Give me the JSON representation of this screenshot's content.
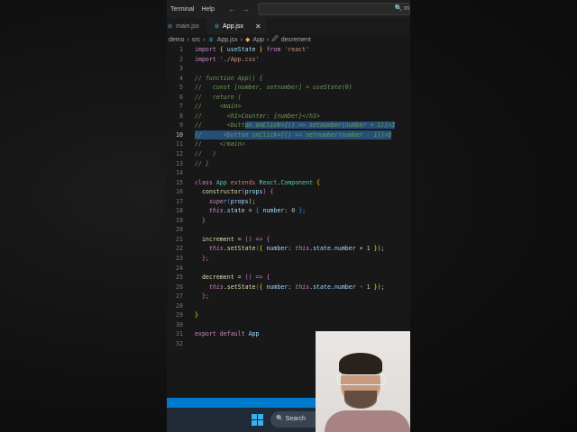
{
  "menubar": {
    "items": [
      "Terminal",
      "Help"
    ],
    "back": "←",
    "forward": "→",
    "search_hint": "🔍 m"
  },
  "tabs": [
    {
      "label": "main.jsx",
      "active": false
    },
    {
      "label": "App.jsx",
      "active": true,
      "close": "✕"
    }
  ],
  "breadcrumb": [
    "demo",
    "src",
    "App.jsx",
    "App",
    "decrement"
  ],
  "taskbar": {
    "search": "Search"
  },
  "code": [
    [
      [
        "import",
        "kw"
      ],
      [
        " { ",
        "br"
      ],
      [
        "useState",
        "var"
      ],
      [
        " } ",
        "br"
      ],
      [
        "from",
        "kw"
      ],
      [
        " 'react'",
        "str"
      ]
    ],
    [
      [
        "import",
        "kw"
      ],
      [
        " './App.css'",
        "str"
      ]
    ],
    [],
    [
      [
        "// function App() {",
        "com"
      ]
    ],
    [
      [
        "//   const [number, setnumber] = useState(0)",
        "com"
      ]
    ],
    [
      [
        "//   return (",
        "com"
      ]
    ],
    [
      [
        "//     <main>",
        "com"
      ]
    ],
    [
      [
        "//       <h1>Counter: {number}</h1>",
        "com"
      ]
    ],
    [
      [
        "//       <button onClick={() => setnumber(number + 1)}>I",
        "com"
      ]
    ],
    [
      [
        "//      <button onClick={() => setnumber(number - 1)}>D",
        "com"
      ]
    ],
    [
      [
        "//     </main>",
        "com"
      ]
    ],
    [
      [
        "//   )",
        "com"
      ]
    ],
    [
      [
        "// }",
        "com"
      ]
    ],
    [],
    [
      [
        "class ",
        "kw"
      ],
      [
        "App ",
        "cls"
      ],
      [
        "extends ",
        "ext"
      ],
      [
        "React",
        "cls"
      ],
      [
        ".",
        "pl"
      ],
      [
        "Component",
        "cls"
      ],
      [
        " {",
        "br"
      ]
    ],
    [
      [
        "  constructor",
        "fn"
      ],
      [
        "(",
        "br2"
      ],
      [
        "props",
        "var"
      ],
      [
        ") ",
        "br2"
      ],
      [
        "{",
        "br2"
      ]
    ],
    [
      [
        "    super",
        "this"
      ],
      [
        "(",
        "br3"
      ],
      [
        "props",
        "var"
      ],
      [
        ");",
        "op"
      ]
    ],
    [
      [
        "    this",
        "this"
      ],
      [
        ".state",
        "var"
      ],
      [
        " = ",
        "op"
      ],
      [
        "{ ",
        "br3"
      ],
      [
        "number",
        "var"
      ],
      [
        ": ",
        "op"
      ],
      [
        "0",
        "num"
      ],
      [
        " };",
        "br3"
      ]
    ],
    [
      [
        "  }",
        "br2"
      ]
    ],
    [],
    [
      [
        "  increment",
        "fn"
      ],
      [
        " = ",
        "op"
      ],
      [
        "() ",
        "br2"
      ],
      [
        "=> ",
        "kw"
      ],
      [
        "{",
        "br2"
      ]
    ],
    [
      [
        "    this",
        "this"
      ],
      [
        ".setState",
        "fn"
      ],
      [
        "(",
        "br3"
      ],
      [
        "{ ",
        "br"
      ],
      [
        "number",
        "var"
      ],
      [
        ": ",
        "op"
      ],
      [
        "this",
        "this"
      ],
      [
        ".state.number",
        "var"
      ],
      [
        " + ",
        "op"
      ],
      [
        "1",
        "num"
      ],
      [
        " })",
        "br"
      ],
      [
        ";",
        "op"
      ]
    ],
    [
      [
        "  };",
        "br2"
      ]
    ],
    [],
    [
      [
        "  decrement",
        "fn"
      ],
      [
        " = ",
        "op"
      ],
      [
        "() ",
        "br2"
      ],
      [
        "=> ",
        "kw"
      ],
      [
        "{",
        "br2"
      ]
    ],
    [
      [
        "    this",
        "this"
      ],
      [
        ".setState",
        "fn"
      ],
      [
        "(",
        "br3"
      ],
      [
        "{ ",
        "br"
      ],
      [
        "number",
        "var"
      ],
      [
        ": ",
        "op"
      ],
      [
        "this",
        "this"
      ],
      [
        ".state.number",
        "var"
      ],
      [
        " - ",
        "op"
      ],
      [
        "1",
        "num"
      ],
      [
        " })",
        "br"
      ],
      [
        ";",
        "op"
      ]
    ],
    [
      [
        "  };",
        "br2"
      ]
    ],
    [],
    [
      [
        "}",
        "br"
      ]
    ],
    [],
    [
      [
        "export ",
        "kw"
      ],
      [
        "default ",
        "kw"
      ],
      [
        "App",
        "var"
      ]
    ],
    []
  ],
  "selected_line": 10,
  "colors": {
    "accent": "#007acc",
    "selection": "#264f78",
    "editor_bg": "#181818"
  }
}
